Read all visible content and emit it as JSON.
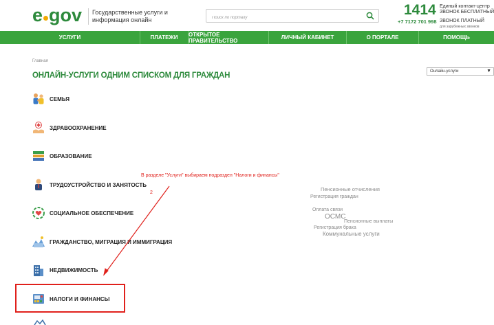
{
  "header": {
    "logo_text": "gov",
    "logo_prefix": "e",
    "tagline": "Государственные услуги и информация онлайн",
    "search_placeholder": "Поиск по порталу",
    "hotline_number": "1414",
    "hotline_desc_1": "Единый контакт-центр",
    "hotline_desc_2": "ЗВОНОК БЕСПЛАТНЫЙ",
    "phone_number": "+7 7172 701 998",
    "phone_desc_1": "ЗВОНОК ПЛАТНЫЙ",
    "phone_desc_2": "для зарубежных звонков"
  },
  "nav": {
    "items": [
      {
        "label": "УСЛУГИ"
      },
      {
        "label": "ПЛАТЕЖИ"
      },
      {
        "label": "ОТКРЫТОЕ ПРАВИТЕЛЬСТВО"
      },
      {
        "label": "ЛИЧНЫЙ КАБИНЕТ"
      },
      {
        "label": "О ПОРТАЛЕ"
      },
      {
        "label": "ПОМОЩЬ"
      }
    ]
  },
  "breadcrumb": "Главная",
  "page_title": "ОНЛАЙН-УСЛУГИ ОДНИМ СПИСКОМ ДЛЯ ГРАЖДАН",
  "view_select": "Онлайн-услуги",
  "categories": [
    {
      "label": "СЕМЬЯ",
      "icon": "family-icon"
    },
    {
      "label": "ЗДРАВООХРАНЕНИЕ",
      "icon": "health-icon"
    },
    {
      "label": "ОБРАЗОВАНИЕ",
      "icon": "books-icon"
    },
    {
      "label": "ТРУДОУСТРОЙСТВО И ЗАНЯТОСТЬ",
      "icon": "worker-icon"
    },
    {
      "label": "СОЦИАЛЬНОЕ ОБЕСПЕЧЕНИЕ",
      "icon": "social-icon"
    },
    {
      "label": "ГРАЖДАНСТВО, МИГРАЦИЯ И ИММИГРАЦИЯ",
      "icon": "migration-icon"
    },
    {
      "label": "НЕДВИЖИМОСТЬ",
      "icon": "building-icon"
    },
    {
      "label": "НАЛОГИ И ФИНАНСЫ",
      "icon": "finance-icon"
    }
  ],
  "annotation": {
    "text": "В разделе \"Услуги\" выбираем подраздел \"Налоги и финансы\"",
    "step": "2"
  },
  "tag_cloud": [
    "Пенсионные отчисления",
    "Регистрация граждан",
    "Оплата связи",
    "ОСМС",
    "Пенсионные выплаты",
    "Регистрация брака",
    "Коммунальные услуги"
  ],
  "colors": {
    "brand_green": "#2d8a3c",
    "nav_green": "#3aa43d",
    "annotation_red": "#e0201b",
    "logo_dot": "#f2a900"
  }
}
